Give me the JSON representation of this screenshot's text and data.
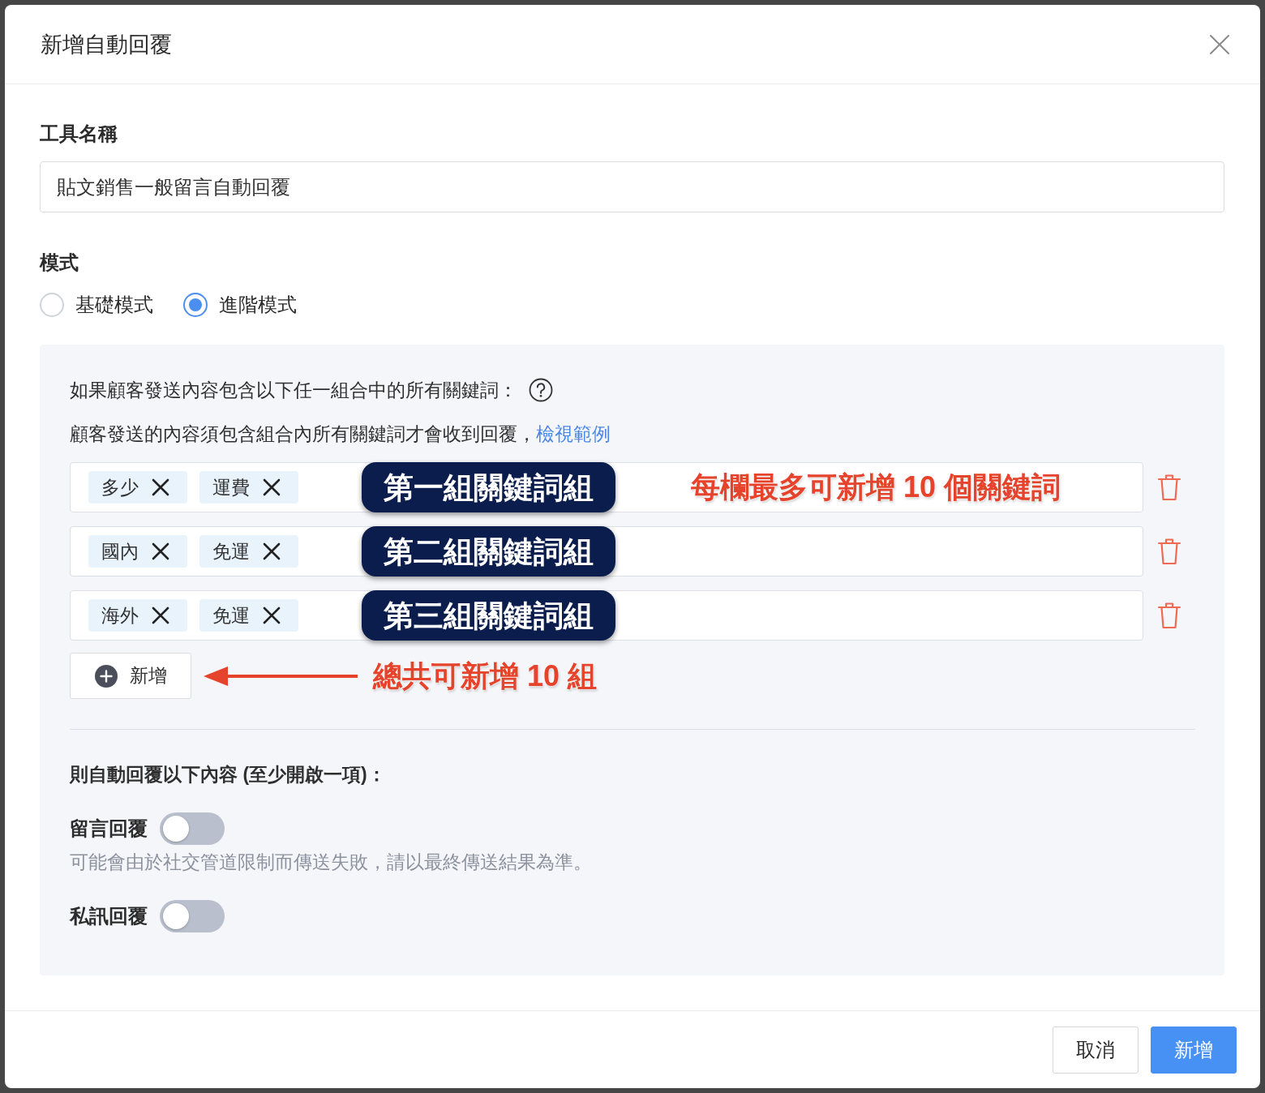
{
  "dialog": {
    "title": "新增自動回覆"
  },
  "tool_name": {
    "label": "工具名稱",
    "value": "貼文銷售一般留言自動回覆"
  },
  "mode": {
    "label": "模式",
    "options": [
      {
        "label": "基礎模式",
        "selected": false
      },
      {
        "label": "進階模式",
        "selected": true
      }
    ]
  },
  "keyword_panel": {
    "intro": "如果顧客發送內容包含以下任一組合中的所有關鍵詞：",
    "hint": "顧客發送的內容須包含組合內所有關鍵詞才會收到回覆，",
    "hint_link": "檢視範例",
    "groups": [
      {
        "keywords": [
          "多少",
          "運費"
        ],
        "annotation": "第一組關鍵詞組",
        "note": "每欄最多可新增 10 個關鍵詞"
      },
      {
        "keywords": [
          "國內",
          "免運"
        ],
        "annotation": "第二組關鍵詞組"
      },
      {
        "keywords": [
          "海外",
          "免運"
        ],
        "annotation": "第三組關鍵詞組"
      }
    ],
    "add_button": "新增",
    "add_note": "總共可新增 10 組"
  },
  "reply_section": {
    "heading": "則自動回覆以下內容 (至少開啟一項)：",
    "options": [
      {
        "label": "留言回覆",
        "on": false,
        "hint": "可能會由於社交管道限制而傳送失敗，請以最終傳送結果為準。"
      },
      {
        "label": "私訊回覆",
        "on": false
      }
    ]
  },
  "footer": {
    "buttons": [
      {
        "label": "取消",
        "kind": "secondary"
      },
      {
        "label": "新增",
        "kind": "primary"
      }
    ]
  }
}
